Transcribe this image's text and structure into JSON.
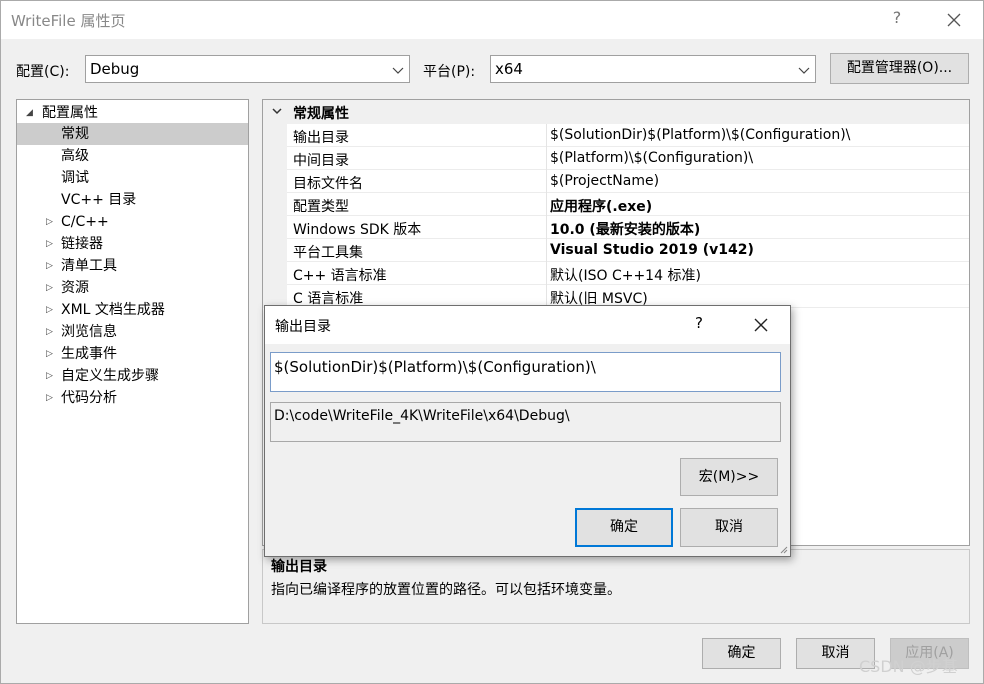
{
  "window": {
    "title": "WriteFile 属性页",
    "help_glyph": "?",
    "close_glyph": "✕"
  },
  "toolbar": {
    "config_label": "配置(C):",
    "config_value": "Debug",
    "platform_label": "平台(P):",
    "platform_value": "x64",
    "config_manager_label": "配置管理器(O)..."
  },
  "tree": {
    "root_label": "配置属性",
    "items": [
      {
        "label": "常规",
        "selected": true
      },
      {
        "label": "高级"
      },
      {
        "label": "调试"
      },
      {
        "label": "VC++ 目录"
      },
      {
        "label": "C/C++",
        "expandable": true
      },
      {
        "label": "链接器",
        "expandable": true
      },
      {
        "label": "清单工具",
        "expandable": true
      },
      {
        "label": "资源",
        "expandable": true
      },
      {
        "label": "XML 文档生成器",
        "expandable": true
      },
      {
        "label": "浏览信息",
        "expandable": true
      },
      {
        "label": "生成事件",
        "expandable": true
      },
      {
        "label": "自定义生成步骤",
        "expandable": true
      },
      {
        "label": "代码分析",
        "expandable": true
      }
    ]
  },
  "grid": {
    "section_title": "常规属性",
    "rows": [
      {
        "name": "输出目录",
        "value": "$(SolutionDir)$(Platform)\\$(Configuration)\\"
      },
      {
        "name": "中间目录",
        "value": "$(Platform)\\$(Configuration)\\"
      },
      {
        "name": "目标文件名",
        "value": "$(ProjectName)"
      },
      {
        "name": "配置类型",
        "value": "应用程序(.exe)",
        "bold": true
      },
      {
        "name": "Windows SDK 版本",
        "value": "10.0 (最新安装的版本)",
        "bold": true
      },
      {
        "name": "平台工具集",
        "value": "Visual Studio 2019 (v142)",
        "bold": true
      },
      {
        "name": "C++ 语言标准",
        "value": "默认(ISO C++14 标准)"
      },
      {
        "name": "C 语言标准",
        "value": "默认(旧 MSVC)"
      }
    ]
  },
  "description": {
    "title": "输出目录",
    "text": "指向已编译程序的放置位置的路径。可以包括环境变量。"
  },
  "footer": {
    "ok_label": "确定",
    "cancel_label": "取消",
    "apply_label": "应用(A)"
  },
  "dialog": {
    "title": "输出目录",
    "help_glyph": "?",
    "edit_value": "$(SolutionDir)$(Platform)\\$(Configuration)\\",
    "evaluated_value": "D:\\code\\WriteFile_4K\\WriteFile\\x64\\Debug\\",
    "macros_label": "宏(M)>>",
    "ok_label": "确定",
    "cancel_label": "取消"
  },
  "watermark": "CSDN @步基"
}
